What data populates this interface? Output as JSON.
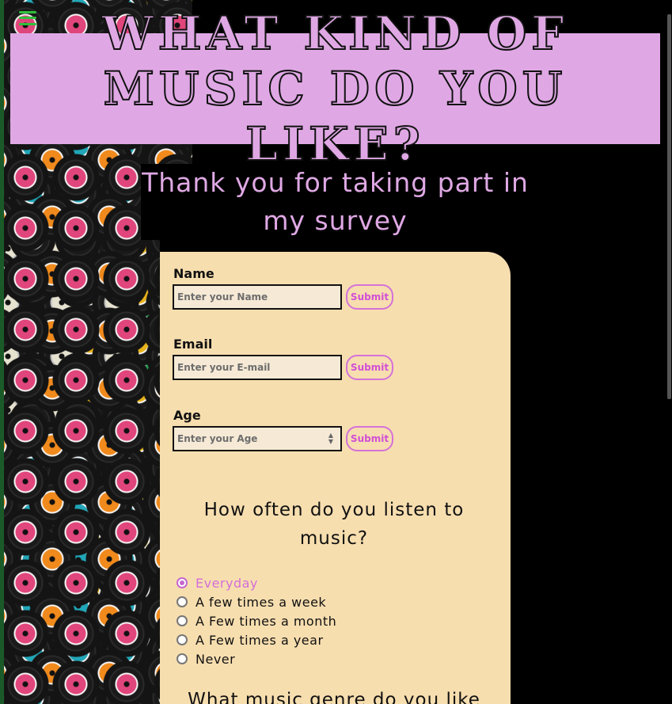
{
  "header": {
    "title": "What kind of music do you like?"
  },
  "subtitle": "Thank you for taking part in my survey",
  "form": {
    "name": {
      "label": "Name",
      "placeholder": "Enter your Name",
      "submit": "Submit"
    },
    "email": {
      "label": "Email",
      "placeholder": "Enter your E-mail",
      "submit": "Submit"
    },
    "age": {
      "label": "Age",
      "placeholder": "Enter your Age",
      "submit": "Submit"
    },
    "frequency": {
      "question": "How often do you listen to music?",
      "options": [
        "Everyday",
        "A few times a week",
        "A Few times a month",
        "A Few times a year",
        "Never"
      ],
      "selected": "Everyday"
    },
    "genre": {
      "question": "What music genre do you like"
    }
  },
  "colors": {
    "accent": "#dfa8e4",
    "card": "#f7deaf",
    "button": "#d14fd6"
  },
  "icons": {
    "menu": "hamburger-menu-icon"
  }
}
